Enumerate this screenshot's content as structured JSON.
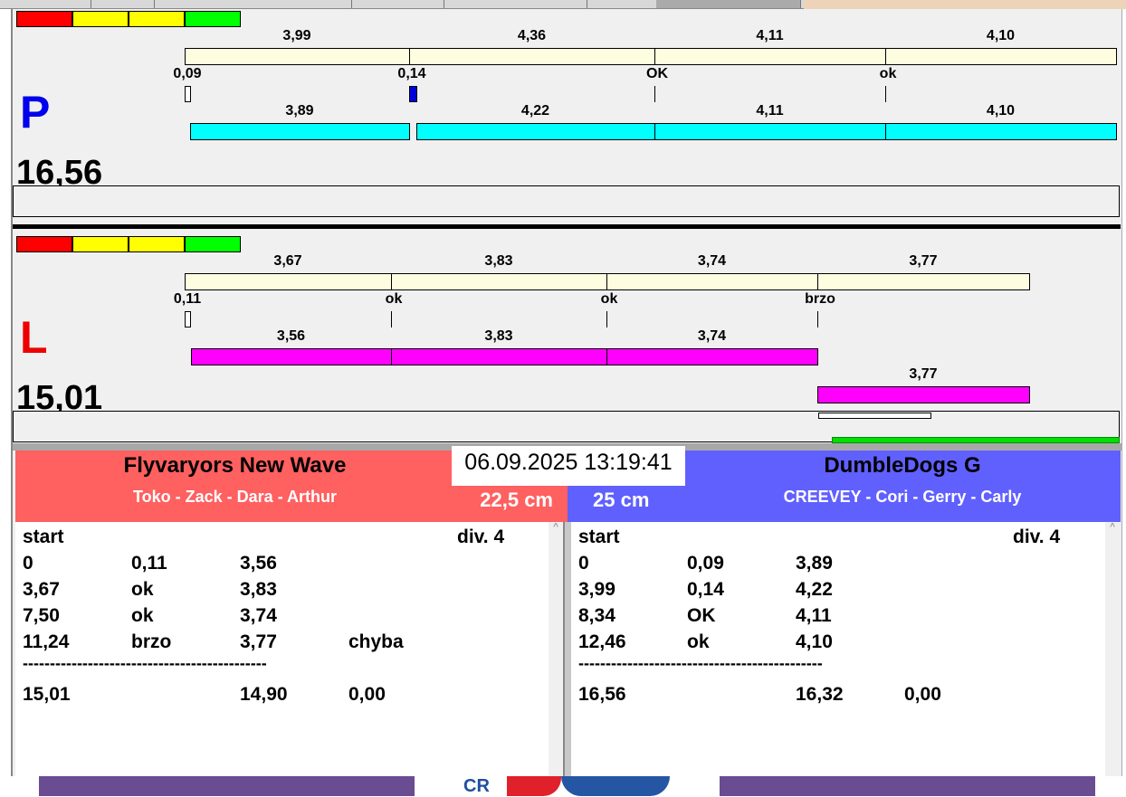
{
  "colors": {
    "red": "#ff0000",
    "yellow": "#ffff00",
    "green": "#00ff00",
    "cream": "#fffde0",
    "cyan": "#00ffff",
    "magenta": "#ff00ff",
    "blue_marker": "#0000dd",
    "left_header": "#ff6060",
    "right_header": "#6060ff"
  },
  "track_p": {
    "letter": "P",
    "total": "16,56",
    "times": [
      "3,99",
      "4,36",
      "4,11",
      "4,10"
    ],
    "reactions": [
      "0,09",
      "0,14",
      "OK",
      "ok"
    ],
    "runs": [
      "3,89",
      "4,22",
      "4,11",
      "4,10"
    ]
  },
  "track_l": {
    "letter": "L",
    "total": "15,01",
    "times": [
      "3,67",
      "3,83",
      "3,74",
      "3,77"
    ],
    "reactions": [
      "0,11",
      "ok",
      "ok",
      "brzo"
    ],
    "runs": [
      "3,56",
      "3,83",
      "3,74"
    ],
    "rerun": "3,77"
  },
  "datetime": "06.09.2025 13:19:41",
  "left_team": {
    "name": "Flyvaryors New Wave",
    "dogs": "Toko - Zack - Dara - Arthur",
    "jump": "22,5 cm",
    "start": "start",
    "div": "div.  4",
    "rows": [
      [
        "0",
        "0,11",
        "3,56",
        ""
      ],
      [
        "3,67",
        "ok",
        "3,83",
        ""
      ],
      [
        "7,50",
        "ok",
        "3,74",
        ""
      ],
      [
        "11,24",
        "brzo",
        "3,77",
        "chyba"
      ]
    ],
    "separator": "---------------------------------------------",
    "totals": [
      "15,01",
      "",
      "14,90",
      "0,00"
    ]
  },
  "right_team": {
    "name": "DumbleDogs G",
    "dogs": "CREEVEY - Cori - Gerry - Carly",
    "jump": "25 cm",
    "start": "start",
    "div": "div.  4",
    "rows": [
      [
        "0",
        "0,09",
        "3,89",
        ""
      ],
      [
        "3,99",
        "0,14",
        "4,22",
        ""
      ],
      [
        "8,34",
        "OK",
        "4,11",
        ""
      ],
      [
        "12,46",
        "ok",
        "4,10",
        ""
      ]
    ],
    "separator": "---------------------------------------------",
    "totals": [
      "16,56",
      "",
      "16,32",
      "0,00"
    ]
  }
}
